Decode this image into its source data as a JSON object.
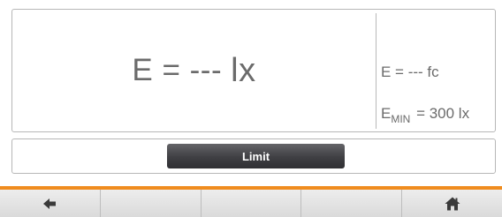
{
  "reading": {
    "main_prefix": "E = ---",
    "main_unit": "lx",
    "fc_text": "E = --- fc",
    "min_symbol": "E",
    "min_subscript": "MIN",
    "min_value": " = 300 lx"
  },
  "limit": {
    "button_label": "Limit"
  },
  "softkeys": [
    {
      "icon": "back-arrow-icon"
    },
    {
      "icon": ""
    },
    {
      "icon": ""
    },
    {
      "icon": ""
    },
    {
      "icon": "home-icon"
    }
  ],
  "colors": {
    "accent": "#f08c1e",
    "text": "#6b6b6b",
    "button": "#3f3f43"
  }
}
